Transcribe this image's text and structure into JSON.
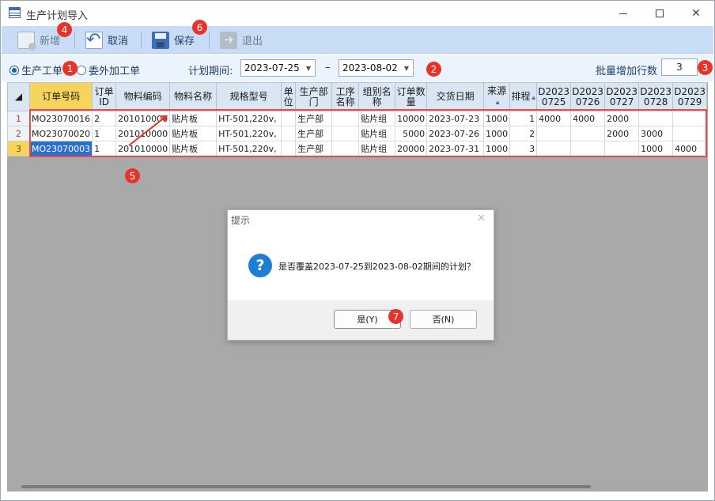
{
  "window": {
    "title": "生产计划导入"
  },
  "toolbar": {
    "new_label": "新增",
    "cancel_label": "取消",
    "save_label": "保存",
    "exit_label": "退出"
  },
  "filter": {
    "radio_production": "生产工单",
    "radio_outsource": "委外加工单",
    "period_label": "计划期间:",
    "date_from": "2023-07-25",
    "date_to": "2023-08-02",
    "separator": "–",
    "batch_label": "批量增加行数",
    "batch_value": "3"
  },
  "grid": {
    "headers": [
      "订单号码",
      "订单ID",
      "物料编码",
      "物料名称",
      "规格型号",
      "单位",
      "生产部门",
      "工序名称",
      "组别名称",
      "订单数量",
      "交货日期",
      "来源",
      "排程",
      "D2023 0725",
      "D2023 0726",
      "D2023 0727",
      "D2023 0728",
      "D2023 0729"
    ],
    "rows": [
      {
        "rownum": "1",
        "order_no": "MO23070016",
        "order_id": "2",
        "material_code": "201010000",
        "material_name": "贴片板",
        "spec": "HT-501,220v,",
        "unit": "",
        "dept": "生产部",
        "process": "",
        "group": "贴片组",
        "qty": "10000",
        "delivery": "2023-07-23",
        "source": "1000",
        "schedule": "1",
        "d0725": "4000",
        "d0726": "4000",
        "d0727": "2000",
        "d0728": "",
        "d0729": ""
      },
      {
        "rownum": "2",
        "order_no": "MO23070020",
        "order_id": "1",
        "material_code": "201010000",
        "material_name": "贴片板",
        "spec": "HT-501,220v,",
        "unit": "",
        "dept": "生产部",
        "process": "",
        "group": "贴片组",
        "qty": "5000",
        "delivery": "2023-07-26",
        "source": "1000",
        "schedule": "2",
        "d0725": "",
        "d0726": "",
        "d0727": "2000",
        "d0728": "3000",
        "d0729": ""
      },
      {
        "rownum": "3",
        "order_no": "MO23070003",
        "order_id": "1",
        "material_code": "201010000",
        "material_name": "贴片板",
        "spec": "HT-501,220v,",
        "unit": "",
        "dept": "生产部",
        "process": "",
        "group": "贴片组",
        "qty": "20000",
        "delivery": "2023-07-31",
        "source": "1000",
        "schedule": "3",
        "d0725": "",
        "d0726": "",
        "d0727": "",
        "d0728": "1000",
        "d0729": "4000"
      }
    ]
  },
  "dialog": {
    "title": "提示",
    "close": "✕",
    "message": "是否覆盖2023-07-25到2023-08-02期间的计划？",
    "yes_label": "是(Y)",
    "no_label": "否(N)"
  },
  "badges": {
    "b1": "1",
    "b2": "2",
    "b3": "3",
    "b4": "4",
    "b5": "5",
    "b6": "6",
    "b7": "7"
  },
  "colors": {
    "toolbar_bg": "#c9dcf5",
    "selected_header": "#f7d55c",
    "annotation_red": "#e8332b",
    "dialog_icon": "#1d7fd4"
  }
}
